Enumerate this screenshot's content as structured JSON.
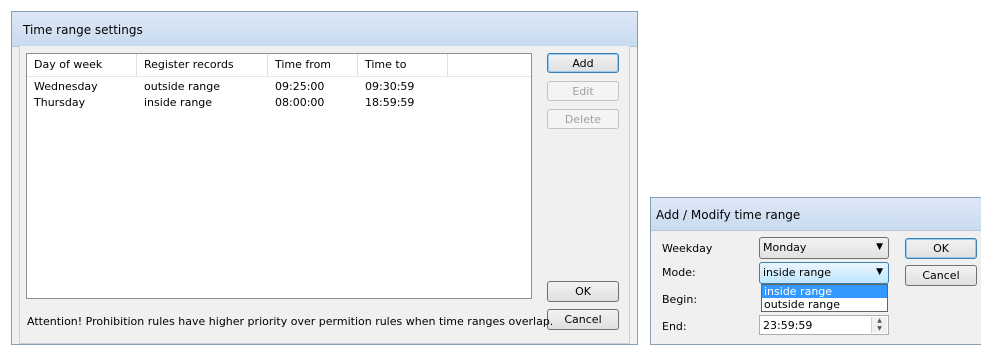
{
  "main_dialog": {
    "title": "Time range settings",
    "columns": [
      "Day of week",
      "Register records",
      "Time from",
      "Time to"
    ],
    "rows": [
      [
        "Wednesday",
        "outside range",
        "09:25:00",
        "09:30:59"
      ],
      [
        "Thursday",
        "inside range",
        "08:00:00",
        "18:59:59"
      ]
    ],
    "buttons": {
      "add": "Add",
      "edit": "Edit",
      "delete": "Delete",
      "ok": "OK",
      "cancel": "Cancel"
    },
    "attention": "Attention! Prohibition rules have higher priority over permition rules when time ranges overlap."
  },
  "modify_dialog": {
    "title": "Add / Modify time range",
    "weekday_label": "Weekday",
    "weekday_value": "Monday",
    "mode_label": "Mode:",
    "mode_value": "inside range",
    "mode_options": [
      "inside range",
      "outside range"
    ],
    "begin_label": "Begin:",
    "end_label": "End:",
    "end_value": "23:59:59",
    "ok": "OK",
    "cancel": "Cancel"
  },
  "colors": {
    "title_bar": "#c9dbf0",
    "selection": "#3399ff",
    "dialog_bg": "#f0f0f0"
  }
}
